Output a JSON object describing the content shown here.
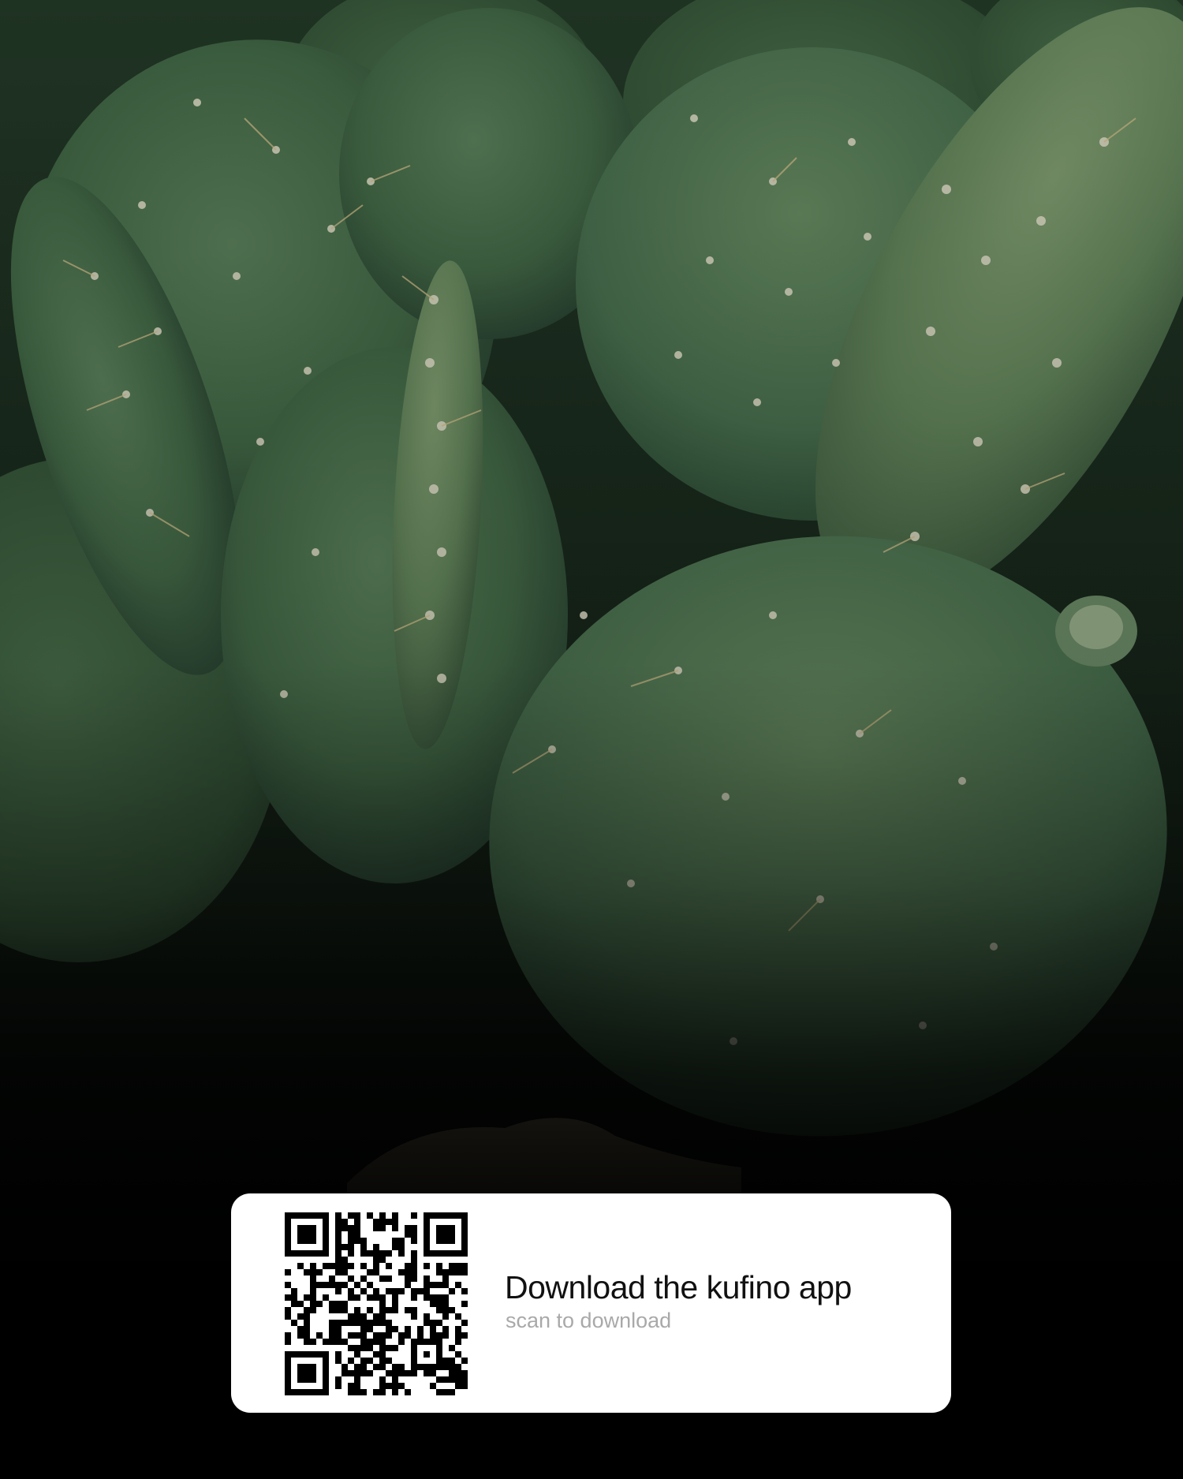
{
  "photo": {
    "subject": "prickly-pear-cactus-pads",
    "colors": {
      "pad_dark": "#2c4a30",
      "pad_mid": "#3f6144",
      "pad_light": "#587852",
      "areole": "#c9c6b3",
      "background": "#050605"
    }
  },
  "download_card": {
    "title": "Download the kufino app",
    "subtitle": "scan to download",
    "qr_icon": "qr-code-icon",
    "colors": {
      "card_background": "#ffffff",
      "title": "#111111",
      "subtitle": "#a9a9a9",
      "qr": "#000000"
    }
  }
}
